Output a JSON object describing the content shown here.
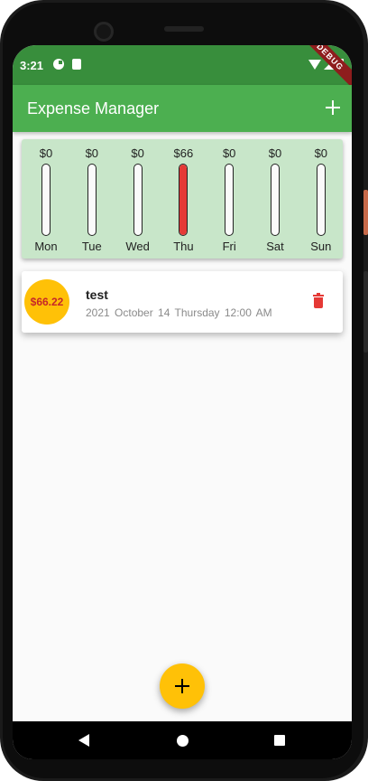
{
  "status_bar": {
    "time": "3:21",
    "debug_banner": "DEBUG"
  },
  "app_bar": {
    "title": "Expense Manager",
    "action_icon": "add-icon"
  },
  "chart": {
    "fill_color": "#e53935",
    "days": [
      {
        "label": "Mon",
        "amount": "$0",
        "fraction": 0
      },
      {
        "label": "Tue",
        "amount": "$0",
        "fraction": 0
      },
      {
        "label": "Wed",
        "amount": "$0",
        "fraction": 0
      },
      {
        "label": "Thu",
        "amount": "$66",
        "fraction": 1
      },
      {
        "label": "Fri",
        "amount": "$0",
        "fraction": 0
      },
      {
        "label": "Sat",
        "amount": "$0",
        "fraction": 0
      },
      {
        "label": "Sun",
        "amount": "$0",
        "fraction": 0
      }
    ]
  },
  "transactions": [
    {
      "amount": "$66.22",
      "title": "test",
      "date": "2021  October 14  Thursday  12:00 AM",
      "delete_icon": "trash-icon"
    }
  ],
  "fab": {
    "icon": "add-icon",
    "color": "#ffc107"
  },
  "colors": {
    "primary": "#4caf50",
    "primary_dark": "#388e3c",
    "chart_background": "#c8e6c9",
    "accent": "#ffc107",
    "danger": "#e53935"
  }
}
